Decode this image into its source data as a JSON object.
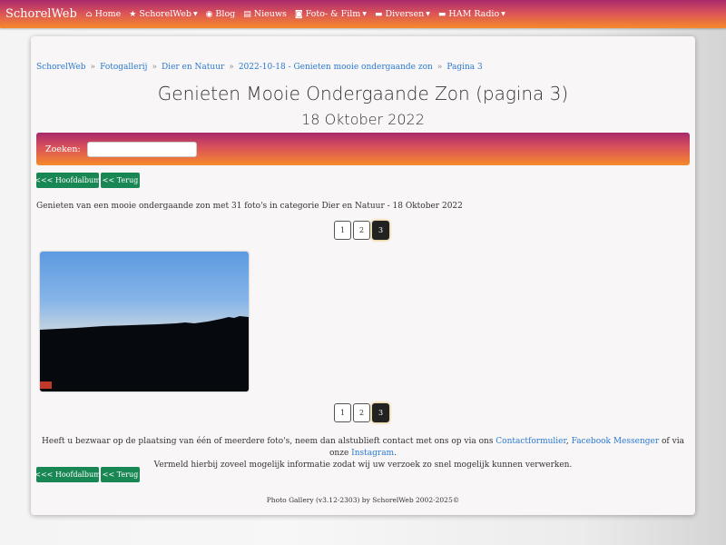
{
  "navbar": {
    "brand": "SchorelWeb",
    "items": [
      {
        "label": "Home",
        "icon": "home-icon",
        "glyph": "⌂",
        "dropdown": false
      },
      {
        "label": "SchorelWeb",
        "icon": "star-icon",
        "glyph": "★",
        "dropdown": true
      },
      {
        "label": "Blog",
        "icon": "rss-icon",
        "glyph": "◉",
        "dropdown": false
      },
      {
        "label": "Nieuws",
        "icon": "newspaper-icon",
        "glyph": "▤",
        "dropdown": false
      },
      {
        "label": "Foto- & Film",
        "icon": "camera-icon",
        "glyph": "◙",
        "dropdown": true
      },
      {
        "label": "Diversen",
        "icon": "folder-icon",
        "glyph": "▬",
        "dropdown": true
      },
      {
        "label": "HAM Radio",
        "icon": "folder-icon",
        "glyph": "▬",
        "dropdown": true
      }
    ]
  },
  "breadcrumb": [
    "SchorelWeb",
    "Fotogallerij",
    "Dier en Natuur",
    "2022-10-18 - Genieten mooie ondergaande zon",
    "Pagina 3"
  ],
  "breadcrumb_sep": "»",
  "title": "Genieten Mooie Ondergaande Zon (pagina 3)",
  "subtitle": "18 Oktober 2022",
  "search": {
    "label": "Zoeken:",
    "value": "",
    "placeholder": ""
  },
  "buttons": {
    "main_album": "<<< Hoofdalbum",
    "back": "<< Terug"
  },
  "description": "Genieten van een mooie ondergaande zon met 31 foto's in categorie Dier en Natuur - 18 Oktober 2022",
  "pagination": {
    "pages": [
      "1",
      "2",
      "3"
    ],
    "current": "3"
  },
  "notice": {
    "part1": "Heeft u bezwaar op de plaatsing van één of meerdere foto's, neem dan alstublieft contact met ons op via ons ",
    "link1": "Contactformulier",
    "comma": ", ",
    "link2": "Facebook Messenger",
    "part2": " of via onze ",
    "link3": "Instagram",
    "part3": ".",
    "line2": "Vermeld hierbij zoveel mogelijk informatie zodat wij uw verzoek zo snel mogelijk kunnen verwerken."
  },
  "footer": "Photo Gallery (v3.12-2303) by SchorelWeb 2002-2025©",
  "colors": {
    "accent_start": "#a8296b",
    "accent_end": "#f68a2b",
    "button": "#198754",
    "link": "#2a7ad0"
  }
}
